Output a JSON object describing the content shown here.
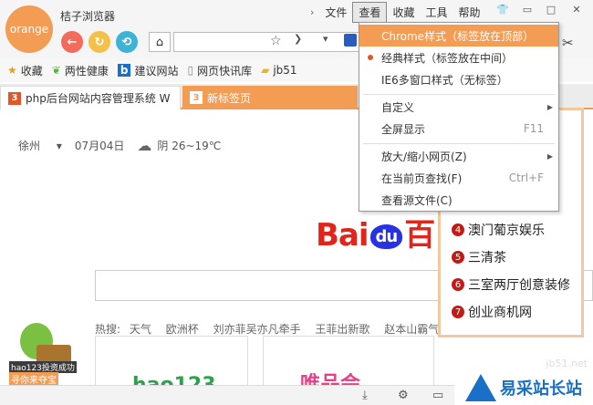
{
  "app": {
    "logo_text": "orange",
    "title": "桔子浏览器"
  },
  "menubar": {
    "items": [
      "文件",
      "查看",
      "收藏",
      "工具",
      "帮助"
    ]
  },
  "window_controls": [
    "shirt-icon",
    "minimize-icon",
    "maximize-icon",
    "close-icon"
  ],
  "address_bar": {
    "value": "",
    "placeholder": ""
  },
  "bookmarks": [
    {
      "label": "收藏",
      "icon": "star-icon"
    },
    {
      "label": "两性健康",
      "icon": "leaf-icon"
    },
    {
      "label": "建议网站",
      "icon": "b-icon"
    },
    {
      "label": "网页快讯库",
      "icon": "page-icon"
    },
    {
      "label": "jb51",
      "icon": "folder-icon"
    }
  ],
  "tabs": [
    {
      "label": "php后台网站内容管理系统 W",
      "active": false
    },
    {
      "label": "新标签页",
      "active": true
    }
  ],
  "weather": {
    "city": "徐州",
    "date": "07月04日",
    "condition": "阴 26~19℃"
  },
  "baidu": {
    "text_before": "Bai",
    "badge": "du",
    "text_after": "百"
  },
  "hotwords": {
    "label": "热搜:",
    "items": [
      "天气",
      "欧洲杯",
      "刘亦菲吴亦凡牵手",
      "王菲出新歌",
      "赵本山霸气"
    ]
  },
  "cards": [
    {
      "text": "hao123"
    },
    {
      "text": "唯品会"
    }
  ],
  "mascot": {
    "line1": "hao123投资成功",
    "line2": "寻你来夺宝"
  },
  "news": [
    {
      "num": "4",
      "title": "澳门葡京娱乐"
    },
    {
      "num": "5",
      "title": "三清茶"
    },
    {
      "num": "6",
      "title": "三室两厅创意装修"
    },
    {
      "num": "7",
      "title": "创业商机网"
    }
  ],
  "watermark": {
    "text": "易采站长站",
    "sub": "jb51.net"
  },
  "dropdown": {
    "items": [
      {
        "label": "Chrome样式（标签放在顶部）",
        "shortcut": "",
        "submenu": false,
        "checked": false,
        "highlight": true
      },
      {
        "label": "经典样式（标签放在中间）",
        "shortcut": "",
        "submenu": false,
        "checked": true,
        "highlight": false
      },
      {
        "label": "IE6多窗口样式（无标签）",
        "shortcut": "",
        "submenu": false,
        "checked": false,
        "highlight": false
      },
      {
        "label": "自定义",
        "shortcut": "",
        "submenu": true,
        "checked": false,
        "highlight": false
      },
      {
        "label": "全屏显示",
        "shortcut": "F11",
        "submenu": false,
        "checked": false,
        "highlight": false
      },
      {
        "label": "放大/缩小网页(Z)",
        "shortcut": "",
        "submenu": true,
        "checked": false,
        "highlight": false
      },
      {
        "label": "在当前页查找(F)",
        "shortcut": "Ctrl+F",
        "submenu": false,
        "checked": false,
        "highlight": false
      },
      {
        "label": "查看源文件(C)",
        "shortcut": "",
        "submenu": false,
        "checked": false,
        "highlight": false
      }
    ]
  },
  "colors": {
    "accent": "#f39c53",
    "baidu_red": "#e1251b",
    "baidu_blue": "#2932e1",
    "news_badge": "#c41a16"
  }
}
